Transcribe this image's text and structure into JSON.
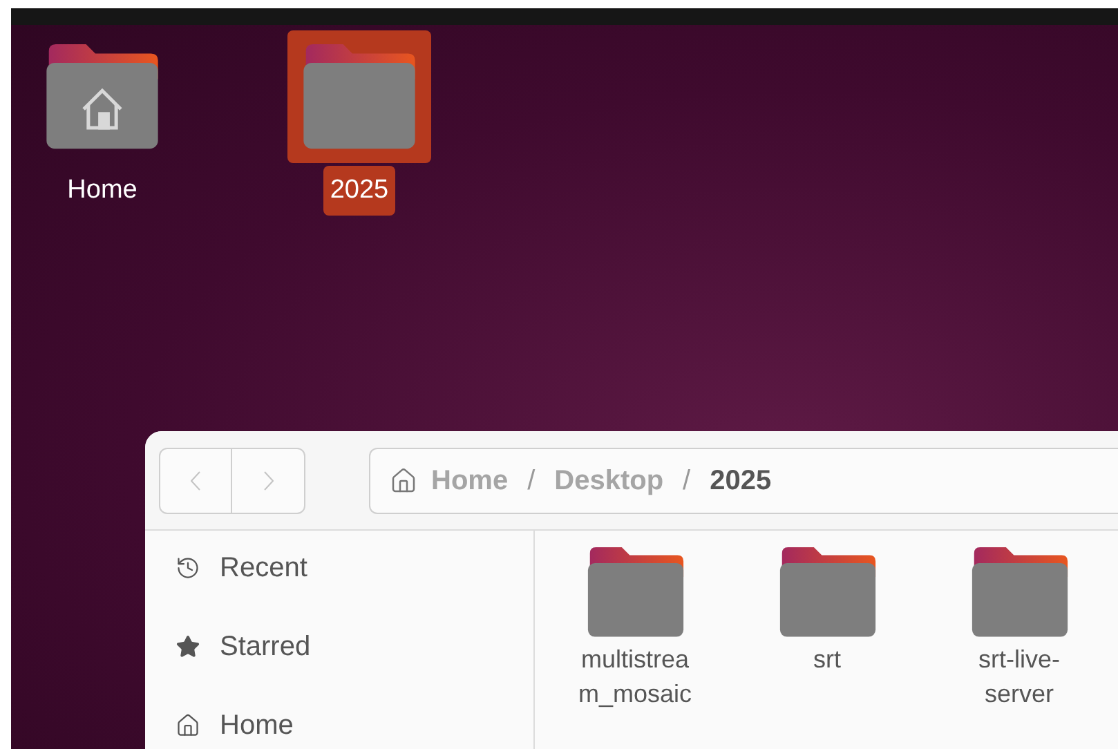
{
  "desktop_icons": [
    {
      "label": "Home",
      "kind": "home",
      "selected": false
    },
    {
      "label": "2025",
      "kind": "folder",
      "selected": true
    }
  ],
  "file_manager": {
    "nav": {
      "back_disabled": true,
      "forward_disabled": true
    },
    "path_separator": "/",
    "path": [
      {
        "label": "Home",
        "current": false
      },
      {
        "label": "Desktop",
        "current": false
      },
      {
        "label": "2025",
        "current": true
      }
    ],
    "sidebar": [
      {
        "label": "Recent",
        "kind": "recent"
      },
      {
        "label": "Starred",
        "kind": "starred"
      },
      {
        "label": "Home",
        "kind": "home"
      }
    ],
    "files": [
      {
        "name": "multistream_mosaic"
      },
      {
        "name": "srt"
      },
      {
        "name": "srt-live-server"
      }
    ]
  }
}
